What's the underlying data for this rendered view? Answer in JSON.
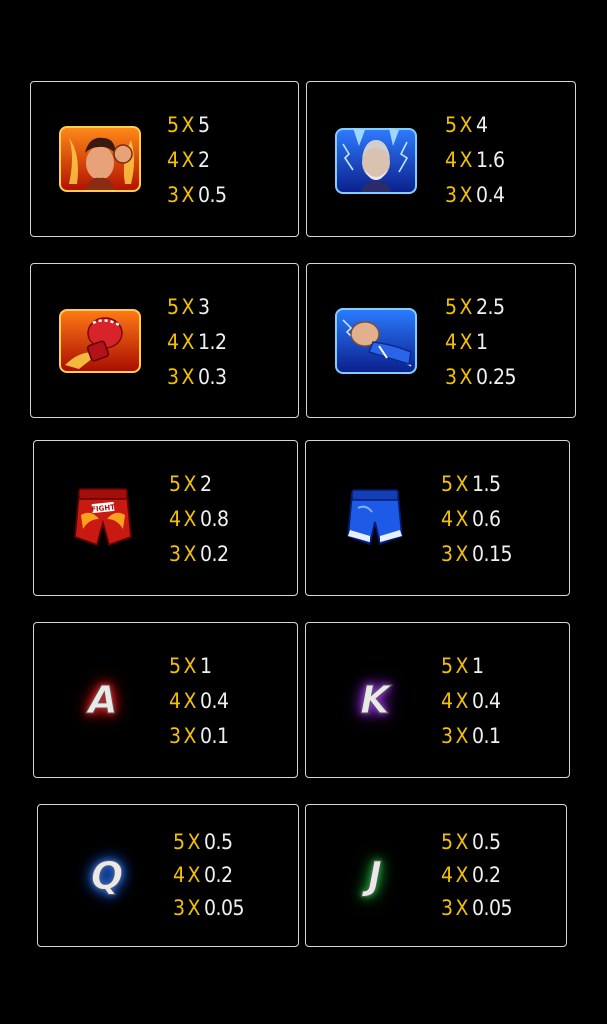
{
  "paytable": [
    {
      "symbol": "red-fighter-icon",
      "pays": [
        {
          "count": "5",
          "mult": "5"
        },
        {
          "count": "4",
          "mult": "2"
        },
        {
          "count": "3",
          "mult": "0.5"
        }
      ]
    },
    {
      "symbol": "blue-fighter-icon",
      "pays": [
        {
          "count": "5",
          "mult": "4"
        },
        {
          "count": "4",
          "mult": "1.6"
        },
        {
          "count": "3",
          "mult": "0.4"
        }
      ]
    },
    {
      "symbol": "red-glove-icon",
      "pays": [
        {
          "count": "5",
          "mult": "3"
        },
        {
          "count": "4",
          "mult": "1.2"
        },
        {
          "count": "3",
          "mult": "0.3"
        }
      ]
    },
    {
      "symbol": "blue-fist-icon",
      "pays": [
        {
          "count": "5",
          "mult": "2.5"
        },
        {
          "count": "4",
          "mult": "1"
        },
        {
          "count": "3",
          "mult": "0.25"
        }
      ]
    },
    {
      "symbol": "red-shorts-icon",
      "text": "FIGHT",
      "pays": [
        {
          "count": "5",
          "mult": "2"
        },
        {
          "count": "4",
          "mult": "0.8"
        },
        {
          "count": "3",
          "mult": "0.2"
        }
      ]
    },
    {
      "symbol": "blue-shorts-icon",
      "pays": [
        {
          "count": "5",
          "mult": "1.5"
        },
        {
          "count": "4",
          "mult": "0.6"
        },
        {
          "count": "3",
          "mult": "0.15"
        }
      ]
    },
    {
      "symbol": "letter-a-icon",
      "letter": "A",
      "glow": "#e02020",
      "pays": [
        {
          "count": "5",
          "mult": "1"
        },
        {
          "count": "4",
          "mult": "0.4"
        },
        {
          "count": "3",
          "mult": "0.1"
        }
      ]
    },
    {
      "symbol": "letter-k-icon",
      "letter": "K",
      "glow": "#9a35e0",
      "pays": [
        {
          "count": "5",
          "mult": "1"
        },
        {
          "count": "4",
          "mult": "0.4"
        },
        {
          "count": "3",
          "mult": "0.1"
        }
      ]
    },
    {
      "symbol": "letter-q-icon",
      "letter": "Q",
      "glow": "#2a6ee8",
      "pays": [
        {
          "count": "5",
          "mult": "0.5"
        },
        {
          "count": "4",
          "mult": "0.2"
        },
        {
          "count": "3",
          "mult": "0.05"
        }
      ]
    },
    {
      "symbol": "letter-j-icon",
      "letter": "J",
      "glow": "#1fa53a",
      "pays": [
        {
          "count": "5",
          "mult": "0.5"
        },
        {
          "count": "4",
          "mult": "0.2"
        },
        {
          "count": "3",
          "mult": "0.05"
        }
      ]
    }
  ],
  "x_label": "X",
  "colors": {
    "count": "#f2c200",
    "value": "#f0f0f0",
    "border": "#d6d6d6",
    "background": "#000000"
  }
}
